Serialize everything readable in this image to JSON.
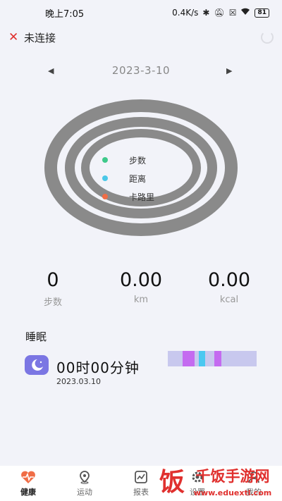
{
  "status_bar": {
    "time": "晚上7:05",
    "speed": "0.4K/s",
    "icons": [
      "bluetooth-icon",
      "mute-icon",
      "sim-off-icon",
      "wifi-icon"
    ],
    "battery": "81"
  },
  "header": {
    "connection_icon": "close-icon",
    "connection_status": "未连接",
    "refresh_icon": "refresh-icon"
  },
  "date_nav": {
    "prev_icon": "triangle-left-icon",
    "date": "2023-3-10",
    "next_icon": "triangle-right-icon"
  },
  "rings": {
    "ring_color": "#8a8a8a",
    "legend": [
      {
        "label": "步数",
        "color": "#3ec98a"
      },
      {
        "label": "距离",
        "color": "#4bc8e8"
      },
      {
        "label": "卡路里",
        "color": "#f06d46"
      }
    ]
  },
  "stats": [
    {
      "value": "0",
      "label": "步数"
    },
    {
      "value": "0.00",
      "label": "km"
    },
    {
      "value": "0.00",
      "label": "kcal"
    }
  ],
  "sleep": {
    "title": "睡眠",
    "icon": "moon-icon",
    "duration": "00时00分钟",
    "date": "2023.03.10",
    "bar_colors": [
      "#c8c8ee",
      "#c46bf0",
      "#c8c8ee",
      "#4bc8f0",
      "#c8c8ee",
      "#c46bf0",
      "#c8c8ee"
    ]
  },
  "bottom_nav": [
    {
      "label": "健康",
      "icon": "heart-pulse-icon",
      "active": true
    },
    {
      "label": "运动",
      "icon": "location-pin-icon",
      "active": false
    },
    {
      "label": "报表",
      "icon": "chart-line-icon",
      "active": false
    },
    {
      "label": "设置",
      "icon": "gear-icon",
      "active": false
    },
    {
      "label": "我的",
      "icon": "user-icon",
      "active": false
    }
  ],
  "watermark": {
    "brand_char": "饭",
    "brand_name": "千饭手游网",
    "url": "www.eduextl.com"
  }
}
